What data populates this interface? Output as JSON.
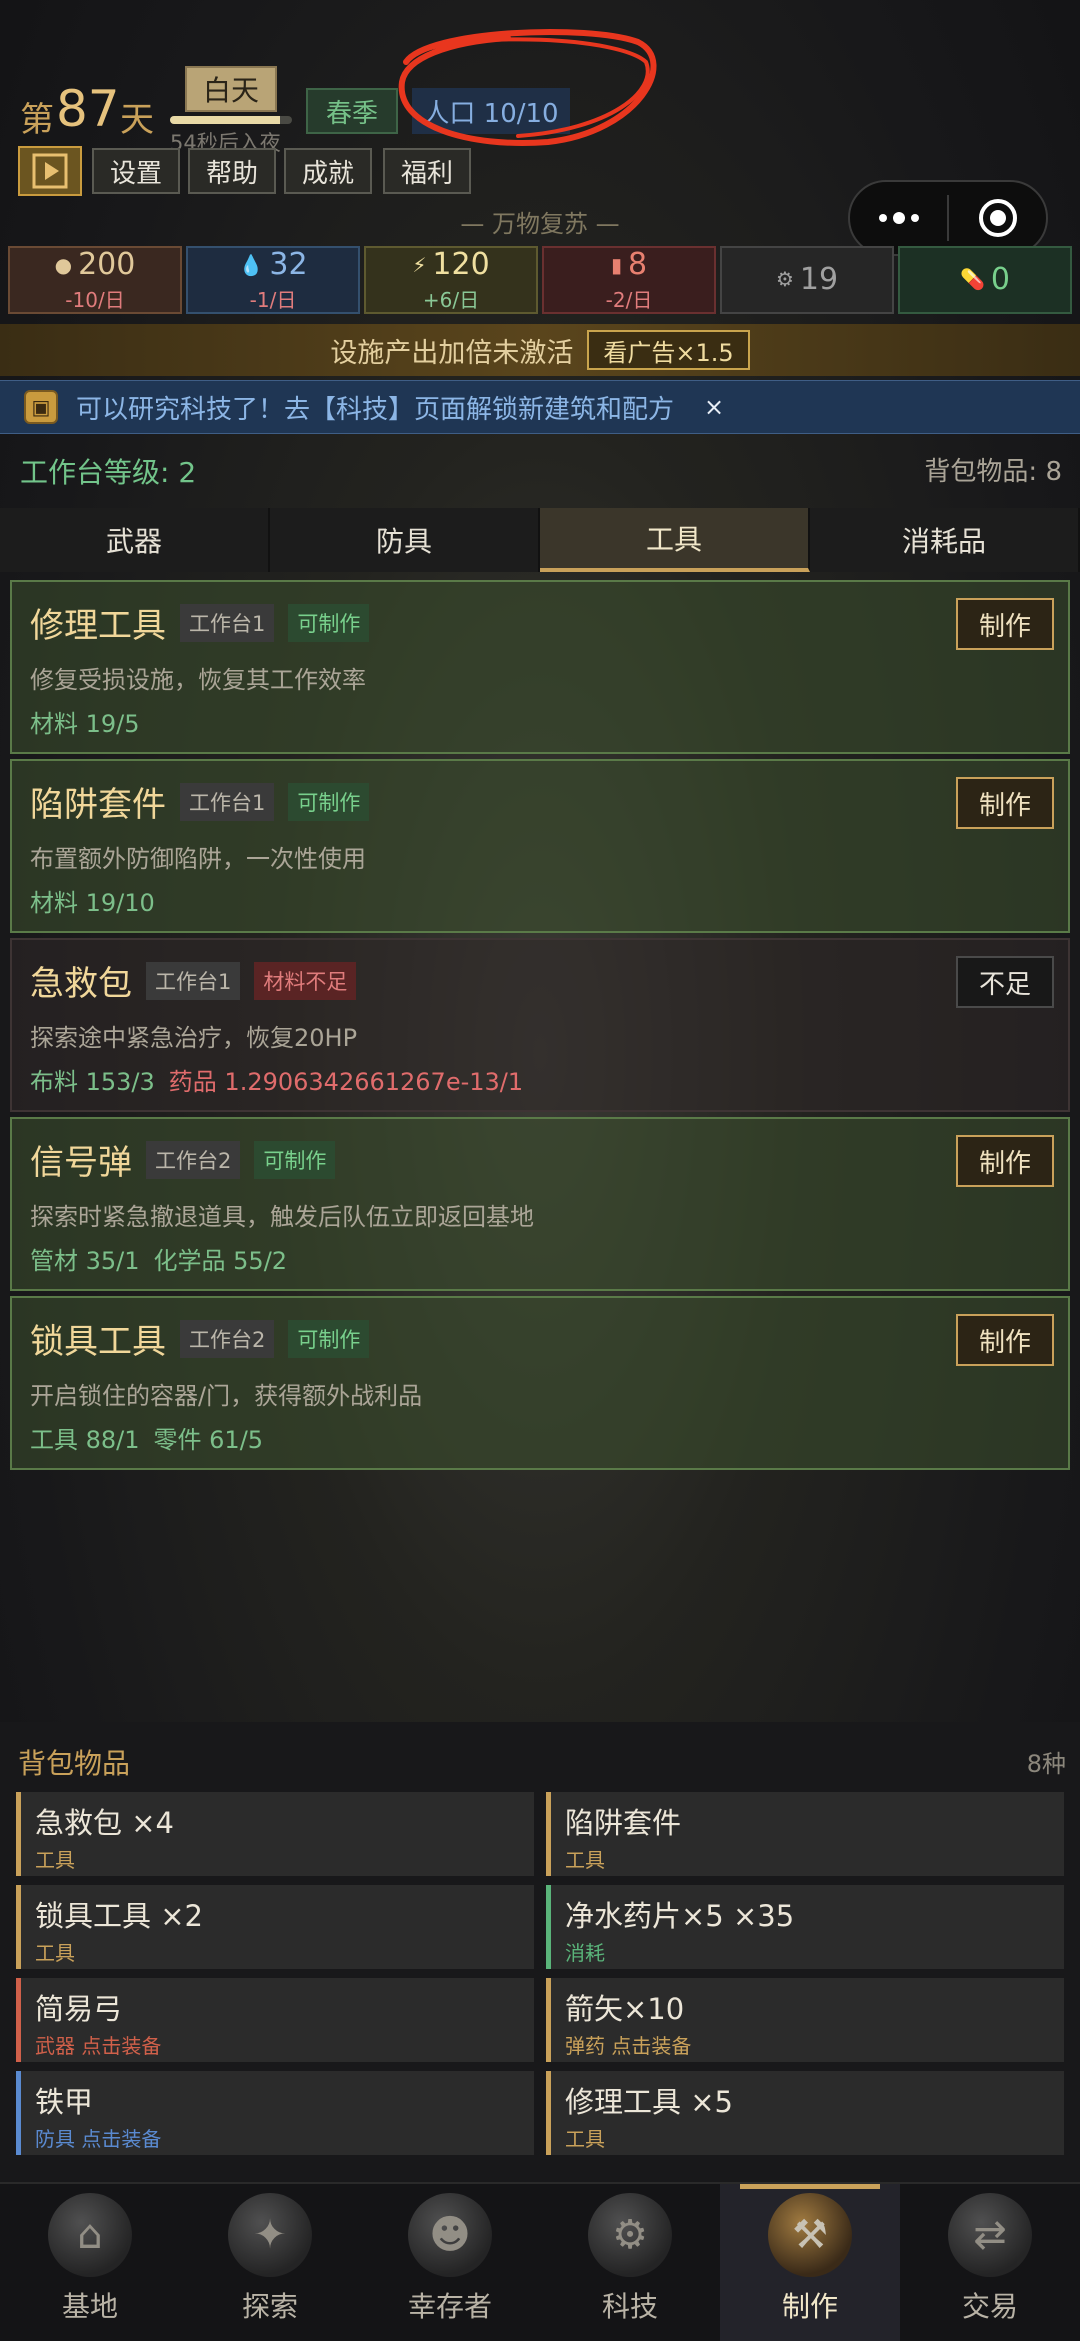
{
  "header": {
    "day_prefix": "第",
    "day_number": "87",
    "day_suffix": "天",
    "phase": "白天",
    "night_countdown": "54秒后入夜",
    "night_progress": 0.9,
    "season": "春季",
    "population": "人口 10/10",
    "buttons": {
      "settings": "设置",
      "help": "帮助",
      "achievements": "成就",
      "welfare": "福利"
    },
    "motto": "— 万物复苏 —"
  },
  "resources": [
    {
      "icon": "bread-icon",
      "glyph": "●",
      "value": "200",
      "rate": "-10/日",
      "color": "#e0c89a",
      "rate_color": "#e07c7c",
      "bg": "#3a2820",
      "border": "#6a4a34"
    },
    {
      "icon": "water-drop-icon",
      "glyph": "💧",
      "value": "32",
      "rate": "-1/日",
      "color": "#8cb6e6",
      "rate_color": "#e07c7c",
      "bg": "#1e2c40",
      "border": "#34506e"
    },
    {
      "icon": "lightning-icon",
      "glyph": "⚡",
      "value": "120",
      "rate": "+6/日",
      "color": "#f0e0a0",
      "rate_color": "#8ac896",
      "bg": "#34321c",
      "border": "#5e5a30"
    },
    {
      "icon": "fuel-can-icon",
      "glyph": "▮",
      "value": "8",
      "rate": "-2/日",
      "color": "#e88070",
      "rate_color": "#e07c7c",
      "bg": "#3a1e1e",
      "border": "#6a3030"
    },
    {
      "icon": "gear-icon",
      "glyph": "⚙",
      "value": "19",
      "rate": "",
      "color": "#a0a0a0",
      "rate_color": "#a0a0a0",
      "bg": "#262626",
      "border": "#444444"
    },
    {
      "icon": "pill-icon",
      "glyph": "💊",
      "value": "0",
      "rate": "",
      "color": "#78d08c",
      "rate_color": "#78d08c",
      "bg": "#1c3024",
      "border": "#345a40"
    }
  ],
  "boost": {
    "text": "设施产出加倍未激活",
    "button": "看广告×1.5"
  },
  "tech_notice": {
    "text": "可以研究科技了！去【科技】页面解锁新建筑和配方",
    "close": "×"
  },
  "workbench": {
    "level": "工作台等级: 2",
    "bag_count": "背包物品: 8"
  },
  "tabs": [
    "武器",
    "防具",
    "工具",
    "消耗品"
  ],
  "active_tab": 2,
  "recipes": [
    {
      "name": "修理工具",
      "bench": "工作台1",
      "status": "可制作",
      "desc": "修复受损设施，恢复其工作效率",
      "mats": [
        "材料 19/5"
      ],
      "bad_mats": [],
      "button": "制作",
      "available": true
    },
    {
      "name": "陷阱套件",
      "bench": "工作台1",
      "status": "可制作",
      "desc": "布置额外防御陷阱，一次性使用",
      "mats": [
        "材料 19/10"
      ],
      "bad_mats": [],
      "button": "制作",
      "available": true
    },
    {
      "name": "急救包",
      "bench": "工作台1",
      "status": "材料不足",
      "desc": "探索途中紧急治疗，恢复20HP",
      "mats": [
        "布料 153/3"
      ],
      "bad_mats": [
        "药品 1.2906342661267e-13/1"
      ],
      "button": "不足",
      "available": false
    },
    {
      "name": "信号弹",
      "bench": "工作台2",
      "status": "可制作",
      "desc": "探索时紧急撤退道具，触发后队伍立即返回基地",
      "mats": [
        "管材 35/1",
        "化学品 55/2"
      ],
      "bad_mats": [],
      "button": "制作",
      "available": true
    },
    {
      "name": "锁具工具",
      "bench": "工作台2",
      "status": "可制作",
      "desc": "开启锁住的容器/门，获得额外战利品",
      "mats": [
        "工具 88/1",
        "零件 61/5"
      ],
      "bad_mats": [],
      "button": "制作",
      "available": true
    }
  ],
  "inventory": {
    "title": "背包物品",
    "kinds": "8种",
    "items": [
      {
        "name": "急救包 ×4",
        "sub": "工具",
        "color": "#c9a15a"
      },
      {
        "name": "陷阱套件",
        "sub": "工具",
        "color": "#c9a15a"
      },
      {
        "name": "锁具工具 ×2",
        "sub": "工具",
        "color": "#c9a15a"
      },
      {
        "name": "净水药片×5 ×35",
        "sub": "消耗",
        "color": "#5ab47a"
      },
      {
        "name": "简易弓",
        "sub": "武器 点击装备",
        "color": "#d0604a"
      },
      {
        "name": "箭矢×10",
        "sub": "弹药 点击装备",
        "color": "#c9a15a"
      },
      {
        "name": "铁甲",
        "sub": "防具 点击装备",
        "color": "#5a8ad0"
      },
      {
        "name": "修理工具 ×5",
        "sub": "工具",
        "color": "#c9a15a"
      }
    ]
  },
  "nav": [
    {
      "label": "基地",
      "icon": "base-icon",
      "glyph": "⌂"
    },
    {
      "label": "探索",
      "icon": "compass-icon",
      "glyph": "✦"
    },
    {
      "label": "幸存者",
      "icon": "survivors-icon",
      "glyph": "☻"
    },
    {
      "label": "科技",
      "icon": "tech-gear-icon",
      "glyph": "⚙"
    },
    {
      "label": "制作",
      "icon": "crafting-icon",
      "glyph": "⚒"
    },
    {
      "label": "交易",
      "icon": "trade-icon",
      "glyph": "⇄"
    }
  ],
  "active_nav": 4
}
